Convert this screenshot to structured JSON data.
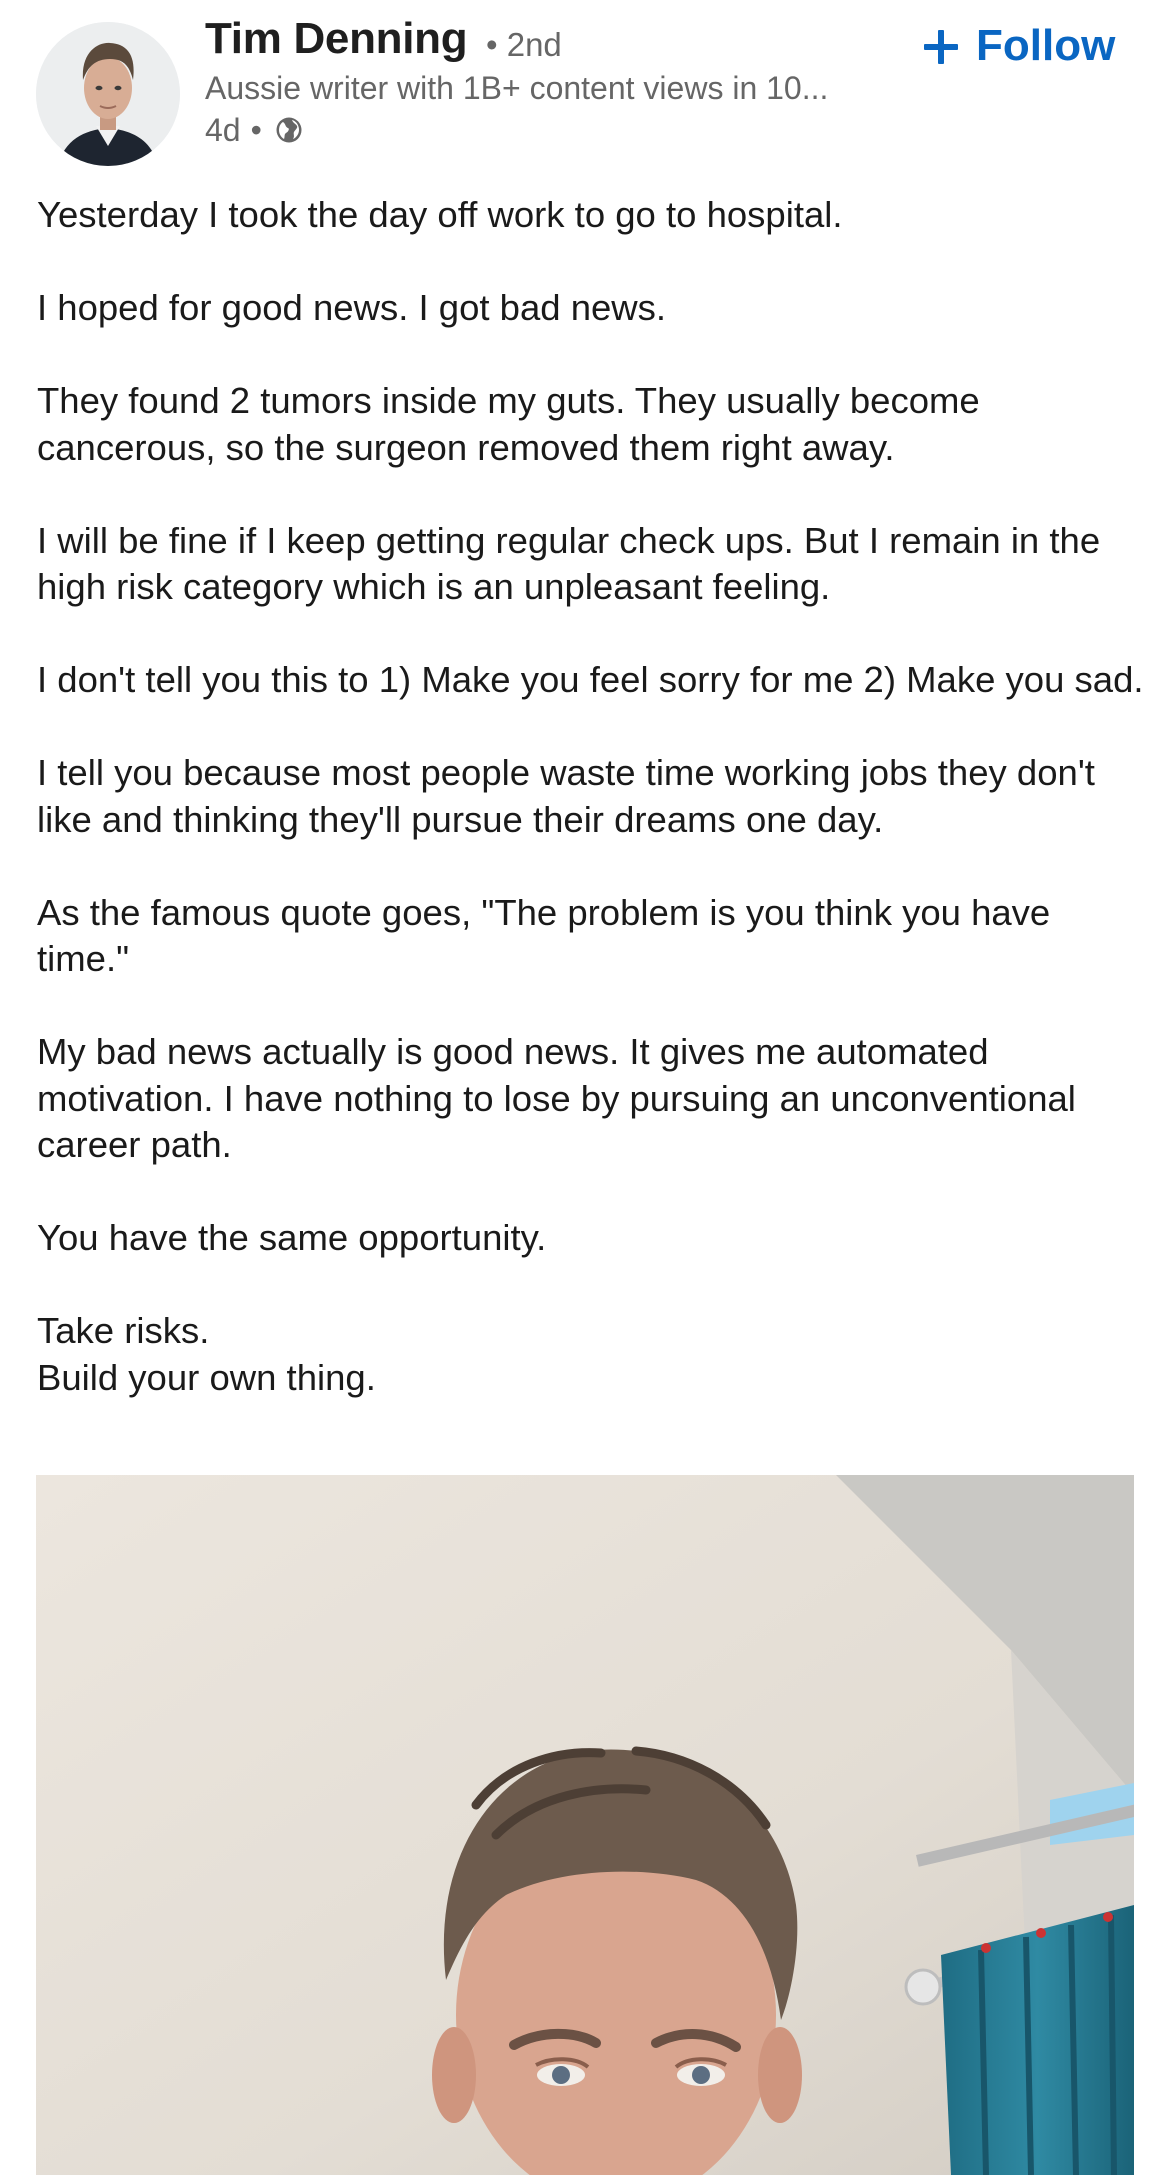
{
  "post": {
    "author": {
      "name": "Tim Denning",
      "degree": "• 2nd",
      "headline": "Aussie writer with 1B+ content views in 10...",
      "age": "4d",
      "separator": "•",
      "visibility_icon": "globe-icon",
      "avatar": "author-avatar-photo"
    },
    "follow": {
      "icon": "plus-icon",
      "label": "Follow",
      "color": "#0a66c2"
    },
    "body": {
      "paragraphs": [
        "Yesterday I took the day off work to go to hospital.",
        "I hoped for good news. I got bad news.",
        "They found 2 tumors inside my guts. They usually become cancerous, so the surgeon removed them right away.",
        "I will be fine if I keep getting regular check ups. But I remain in the high risk category which is an unpleasant feeling.",
        "I don't tell you this to 1) Make you feel sorry for me 2) Make you sad.",
        "I tell you because most people waste time working jobs they don't like and thinking they'll pursue their dreams one day.",
        "As the famous quote goes, \"The problem is you think you have time.\"",
        "My bad news actually is good news. It gives me automated motivation. I have nothing to lose by pursuing an unconventional career path.",
        "You have the same opportunity.",
        "Take risks.",
        "Build your own thing."
      ]
    },
    "image": {
      "subject": "selfie-photo-in-hospital-room"
    }
  }
}
